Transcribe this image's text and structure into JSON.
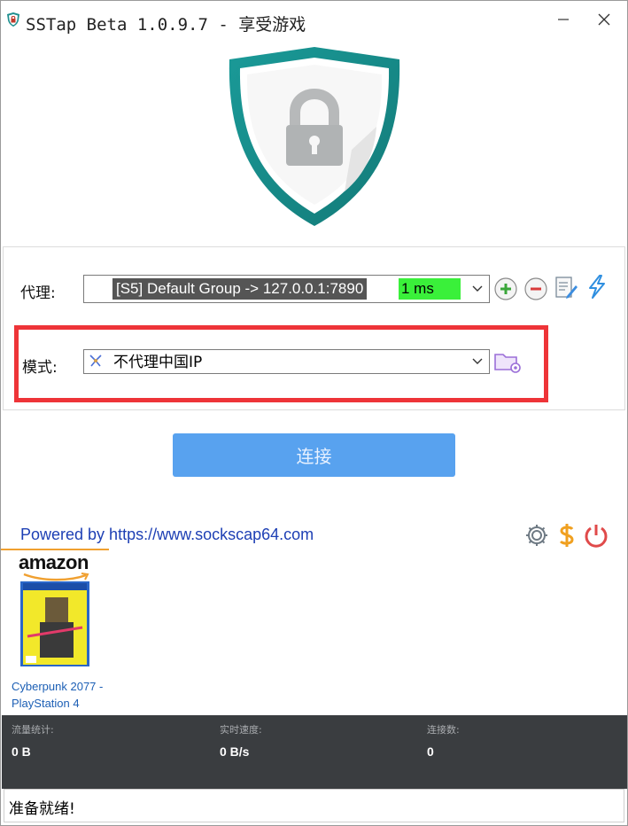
{
  "window": {
    "title": "SSTap Beta 1.0.9.7 - 享受游戏"
  },
  "settings": {
    "proxy_label": "代理:",
    "proxy_selected": "[S5] Default Group -> 127.0.0.1:7890",
    "proxy_ping": "1 ms",
    "mode_label": "模式:",
    "mode_selected": "不代理中国IP"
  },
  "connect": {
    "label": "连接"
  },
  "footer": {
    "powered_by": "Powered by https://www.sockscap64.com"
  },
  "ad": {
    "brand": "amazon",
    "product_title": "Cyberpunk 2077 - PlayStation 4"
  },
  "stats": {
    "traffic_label": "流量统计:",
    "traffic_value": "0 B",
    "speed_label": "实时速度:",
    "speed_value": "0 B/s",
    "connections_label": "连接数:",
    "connections_value": "0"
  },
  "status": {
    "text": "准备就绪!"
  },
  "colors": {
    "accent_button": "#58a2ef",
    "ping_green": "#3af03a",
    "highlight_red": "#ee3438",
    "shield_teal": "#1f8f8f",
    "stats_bg": "#3a3d40"
  }
}
